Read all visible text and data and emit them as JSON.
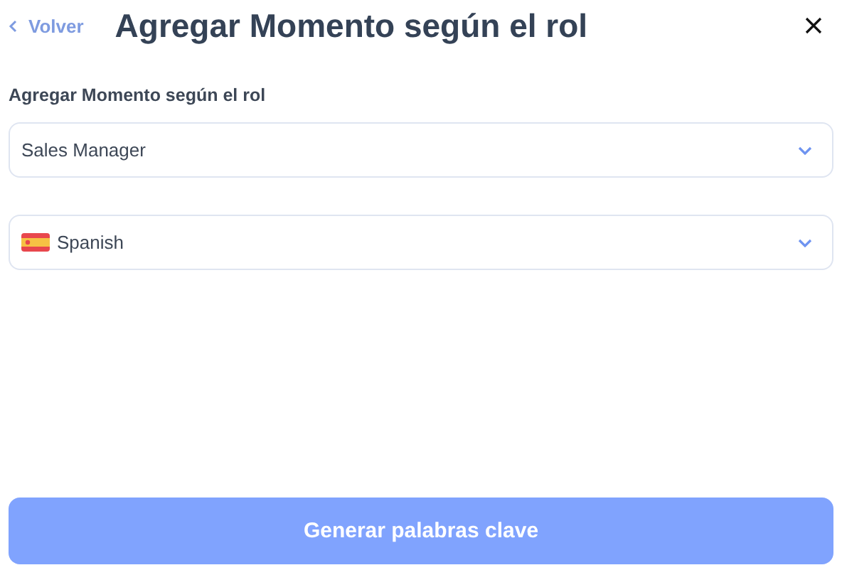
{
  "header": {
    "back_link": "Volver",
    "title": "Agregar Momento según el rol"
  },
  "form": {
    "label": "Agregar Momento según el rol",
    "selects": [
      {
        "kind": "plain",
        "value": "Sales Manager"
      },
      {
        "kind": "language",
        "value": "Spanish"
      }
    ]
  },
  "submit_button": {
    "label": "Generar palabras clave",
    "disabled": true
  }
}
